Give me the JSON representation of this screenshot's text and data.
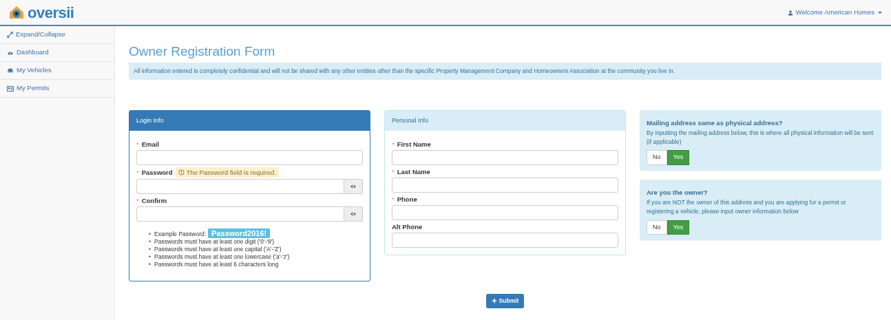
{
  "header": {
    "logo_text": "oversii",
    "user_menu": "Welcome American Homes"
  },
  "sidebar": {
    "items": [
      {
        "label": "Expand/Collapse",
        "kind": "expand"
      },
      {
        "label": "Dashboard",
        "kind": "dashboard"
      },
      {
        "label": "My Vehicles",
        "kind": "vehicles"
      },
      {
        "label": "My Permits",
        "kind": "permits"
      }
    ]
  },
  "page": {
    "title": "Owner Registration Form",
    "notice": "All information entered is completely confidential and will not be shared with any other entities other than the specific Property Management Company and Homeowners Association at the community you live in."
  },
  "login_info": {
    "title": "Login Info",
    "fields": [
      {
        "label": "Email",
        "required_mark": "*",
        "kind": "text"
      },
      {
        "label": "Password",
        "required_mark": "*",
        "kind": "password",
        "error": "The Password field is required."
      },
      {
        "label": "Confirm",
        "required_mark": "*",
        "kind": "password"
      }
    ],
    "bullet": "•",
    "example_label": "Example Password:",
    "example_value": "Password2016!",
    "rules": [
      "Passwords must have at least one digit ('0'-'9')",
      "Passwords must have at least one capital ('A'-'Z')",
      "Passwords must have at least one lowercase ('a'-'z')",
      "Passwords must have at least 6 characters long"
    ]
  },
  "personal_info": {
    "title": "Personal Info",
    "fields": [
      {
        "label": "First Name",
        "required_mark": "*",
        "kind": "text"
      },
      {
        "label": "Last Name",
        "required_mark": "*",
        "kind": "text"
      },
      {
        "label": "Phone",
        "required_mark": "*",
        "kind": "text"
      },
      {
        "label": "Alt Phone",
        "kind": "text"
      }
    ]
  },
  "questions": [
    {
      "title": "Mailing address same as physical address?",
      "text": "By inputting the mailing address below, this is where all physical information will be sent (if applicable)",
      "options": [
        {
          "label": "No",
          "selected": false
        },
        {
          "label": "Yes",
          "selected": true
        }
      ]
    },
    {
      "title": "Are you the owner?",
      "text": "If you are NOT the owner of this address and you are applying for a permit or registering a vehicle, please input owner information below",
      "options": [
        {
          "label": "No",
          "selected": false
        },
        {
          "label": "Yes",
          "selected": true
        }
      ]
    }
  ],
  "submit": {
    "label": "Submit"
  }
}
